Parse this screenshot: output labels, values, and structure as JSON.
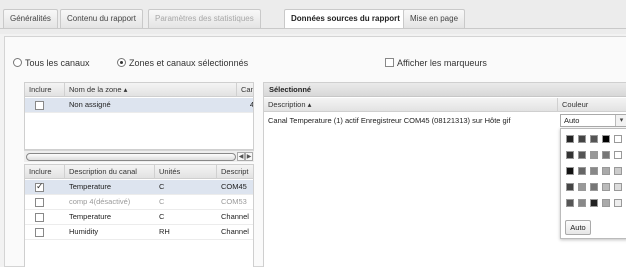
{
  "tabs": [
    {
      "label": "Généralités",
      "state": "normal"
    },
    {
      "label": "Contenu du rapport",
      "state": "normal"
    },
    {
      "label": "Paramètres des statistiques",
      "state": "disabled"
    },
    {
      "label": "Données sources du rapport",
      "state": "active"
    },
    {
      "label": "Mise en page",
      "state": "normal"
    }
  ],
  "filters": {
    "all_channels_label": "Tous les canaux",
    "selected_label": "Zones et canaux sélectionnés",
    "show_markers_label": "Afficher les marqueurs",
    "selected_option": "selected",
    "show_markers": false
  },
  "zones_grid": {
    "headers": [
      "Inclure",
      "Nom de la zone",
      "Can"
    ],
    "rows": [
      {
        "include": false,
        "name": "Non assigné",
        "count": "4"
      }
    ]
  },
  "channels_grid": {
    "headers": [
      "Inclure",
      "Description du canal",
      "Unités",
      "Descript"
    ],
    "rows": [
      {
        "include": true,
        "description": "Temperature",
        "unit": "C",
        "extra": "COM45",
        "selected": true,
        "dim": false
      },
      {
        "include": false,
        "description": "comp 4(désactivé)",
        "unit": "C",
        "extra": "COM53",
        "selected": false,
        "dim": true
      },
      {
        "include": false,
        "description": "Temperature",
        "unit": "C",
        "extra": "Channel",
        "selected": false,
        "dim": false
      },
      {
        "include": false,
        "description": "Humidity",
        "unit": "RH",
        "extra": "Channel",
        "selected": false,
        "dim": false
      }
    ]
  },
  "selected_panel": {
    "title": "Sélectionné",
    "headers": {
      "description": "Description",
      "color": "Couleur"
    },
    "rows": [
      {
        "description": "Canal Temperature (1) actif Enregistreur COM45 (08121313) sur Hôte gif",
        "color": "Auto"
      }
    ]
  },
  "palette": {
    "swatches": [
      [
        "#222222",
        "#444444",
        "#555555",
        "#000000",
        "#ffffff"
      ],
      [
        "#333333",
        "#555555",
        "#999999",
        "#777777",
        "#ffffff"
      ],
      [
        "#111111",
        "#666666",
        "#888888",
        "#aaaaaa",
        "#cccccc"
      ],
      [
        "#444444",
        "#999999",
        "#777777",
        "#bbbbbb",
        "#dddddd"
      ],
      [
        "#555555",
        "#888888",
        "#222222",
        "#aaaaaa",
        "#eeeeee"
      ]
    ],
    "auto_label": "Auto"
  },
  "icons": {
    "sort_ascending": "sort-ascending-icon",
    "scroll_left": "arrow-left-icon",
    "scroll_right": "arrow-right-icon",
    "dropdown": "chevron-down-icon"
  }
}
